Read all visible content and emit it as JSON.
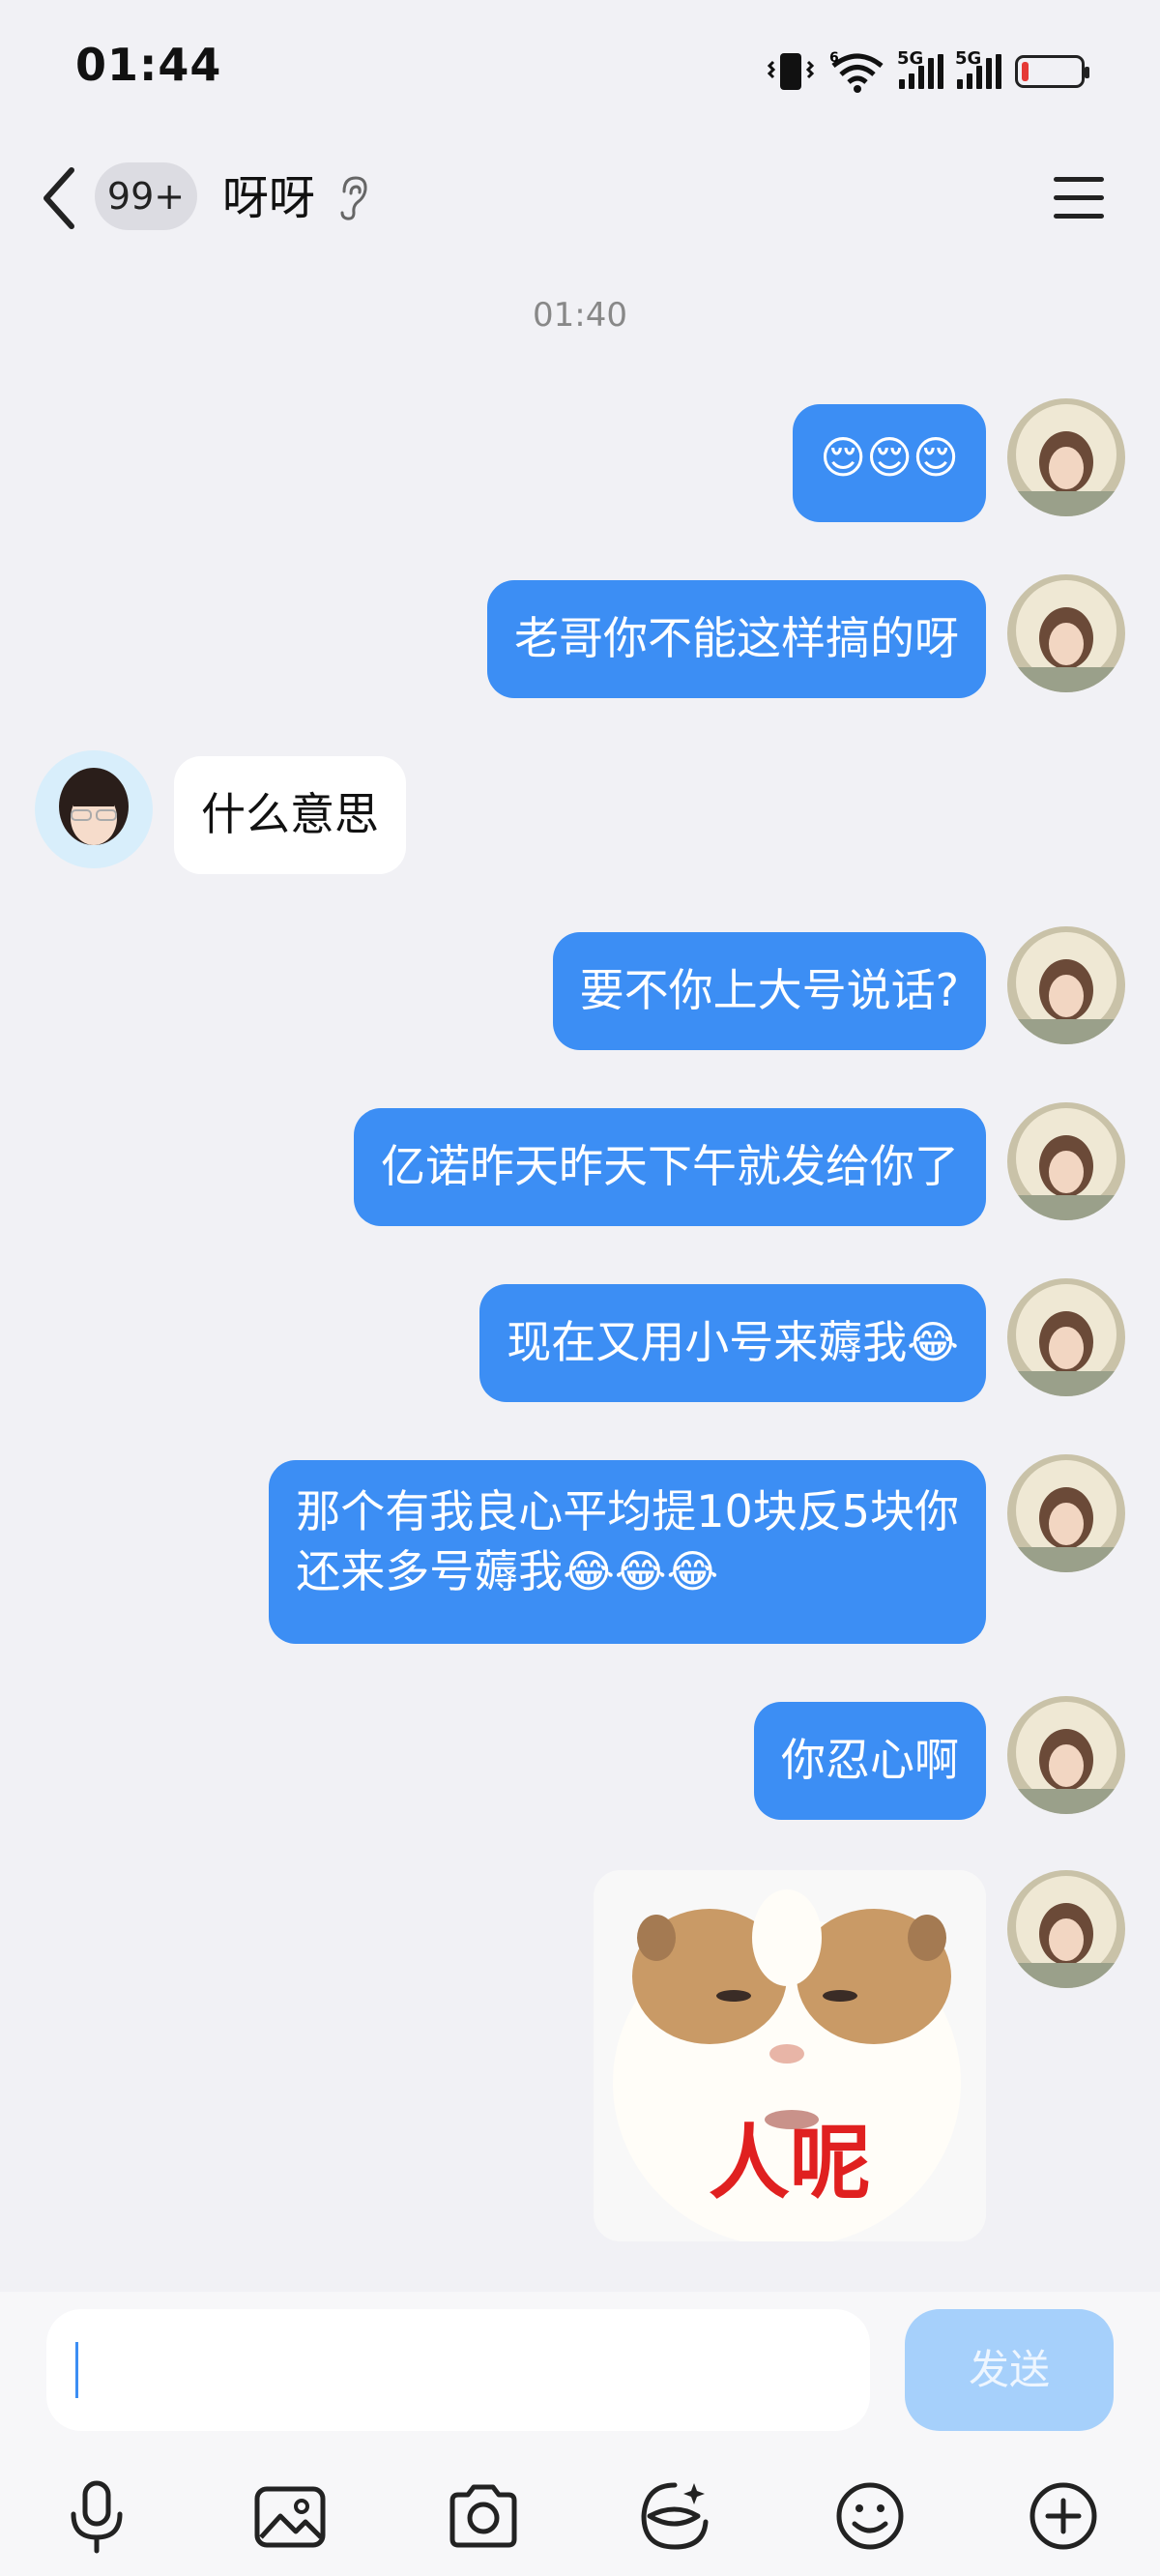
{
  "status_bar": {
    "time": "01:44",
    "net1": "5G",
    "net2": "5G",
    "battery_level": 0.08,
    "battery_color": "#e53935"
  },
  "header": {
    "badge": "99+",
    "title": "呀呀",
    "icons": [
      "back-chevron-icon",
      "ear-icon",
      "menu-icon"
    ]
  },
  "chat": {
    "timestamp": "01:40",
    "messages": [
      {
        "from": "me",
        "text": "😌😌😌"
      },
      {
        "from": "me",
        "text": "老哥你不能这样搞的呀"
      },
      {
        "from": "other",
        "text": "什么意思"
      },
      {
        "from": "me",
        "text": "要不你上大号说话?"
      },
      {
        "from": "me",
        "text": "亿诺昨天昨天下午就发给你了"
      },
      {
        "from": "me",
        "text": "现在又用小号来薅我😂"
      },
      {
        "from": "me",
        "line1": "那个有我良心平均提10块反5块你",
        "line2": "还来多号薅我😂😂😂"
      },
      {
        "from": "me",
        "text": "你忍心啊"
      },
      {
        "from": "me",
        "sticker_caption": "人呢"
      }
    ]
  },
  "input_bar": {
    "value": "",
    "send_label": "发送",
    "tools": [
      "microphone-icon",
      "image-icon",
      "camera-icon",
      "sticker-icon",
      "emoji-icon",
      "plus-icon"
    ]
  },
  "colors": {
    "my_bubble": "#3c8ef4",
    "other_bubble": "#ffffff",
    "background": "#f1f1f5",
    "send_disabled": "#a6d0fb"
  }
}
